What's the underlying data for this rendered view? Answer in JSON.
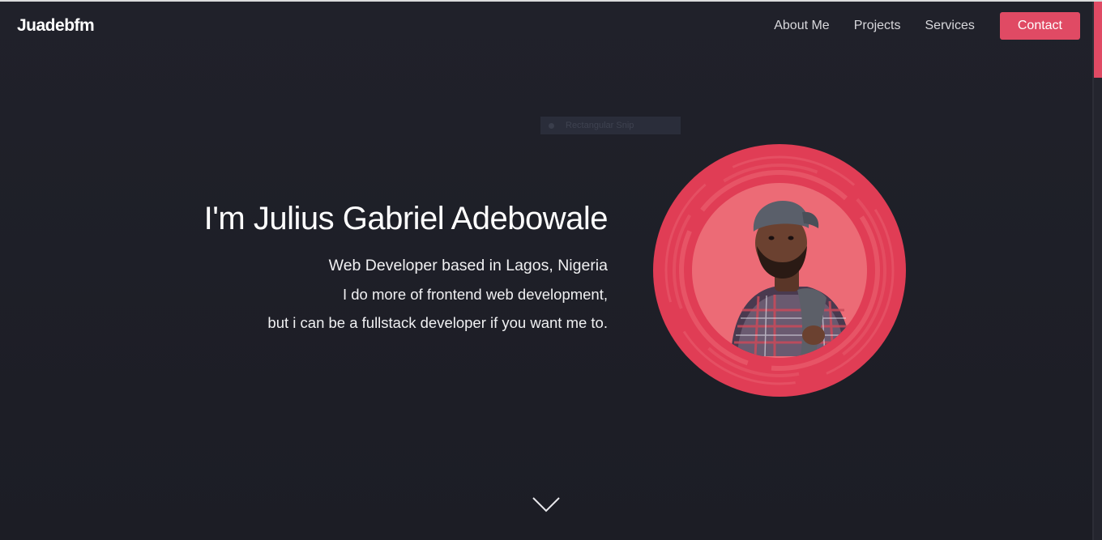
{
  "brand": "Juadebfm",
  "nav": {
    "links": [
      "About Me",
      "Projects",
      "Services"
    ],
    "contact_label": "Contact"
  },
  "overlay": {
    "snip_label": "Rectangular Snip"
  },
  "hero": {
    "title": "I'm Julius Gabriel Adebowale",
    "line1": "Web Developer based in Lagos, Nigeria",
    "line2": "I do more of frontend web development,",
    "line3": "but i can be a fullstack developer if you want me to."
  },
  "icons": {
    "scroll_down": "chevron-down-icon",
    "avatar": "profile-photo"
  },
  "colors": {
    "accent": "#e04a64",
    "background": "#1f2029",
    "avatar_outer": "#e03d55",
    "avatar_inner": "#ec6b76"
  }
}
